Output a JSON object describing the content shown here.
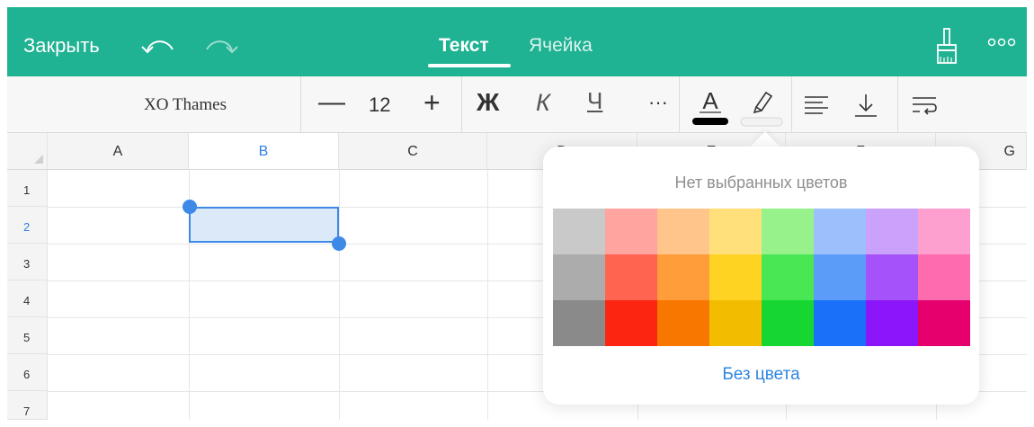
{
  "topbar": {
    "close_label": "Закрыть",
    "tabs": [
      {
        "label": "Текст",
        "active": true
      },
      {
        "label": "Ячейка",
        "active": false
      }
    ],
    "accent_color": "#1fb293"
  },
  "toolbar": {
    "font_name": "XO Thames",
    "font_size": "12",
    "minus_label": "—",
    "plus_label": "+",
    "bold_label": "Ж",
    "italic_label": "К",
    "underline_label": "Ч",
    "more_label": "···",
    "text_color_label": "A",
    "icons": [
      "text-color-icon",
      "highlight-pen-icon",
      "align-left-icon",
      "align-bottom-icon",
      "text-wrap-icon"
    ]
  },
  "sheet": {
    "columns": [
      "A",
      "B",
      "C",
      "D",
      "E",
      "F",
      "G"
    ],
    "rows": [
      "1",
      "2",
      "3",
      "4",
      "5",
      "6",
      "7"
    ],
    "selected_cell": "B2"
  },
  "color_popover": {
    "title": "Нет выбранных цветов",
    "no_color_label": "Без цвета",
    "swatch_rows": [
      [
        "#c9c9c9",
        "#ffa49e",
        "#ffc58a",
        "#ffe07a",
        "#97f28c",
        "#9cc0fb",
        "#caa2fb",
        "#fd9fcf"
      ],
      [
        "#acacac",
        "#ff6451",
        "#ff9d3b",
        "#ffd321",
        "#4ae754",
        "#5c9cf9",
        "#a652fa",
        "#fd6caf"
      ],
      [
        "#8a8a8a",
        "#fc2511",
        "#f87700",
        "#f2bc00",
        "#16d731",
        "#1a70f8",
        "#8b16f9",
        "#e5006d"
      ]
    ]
  }
}
